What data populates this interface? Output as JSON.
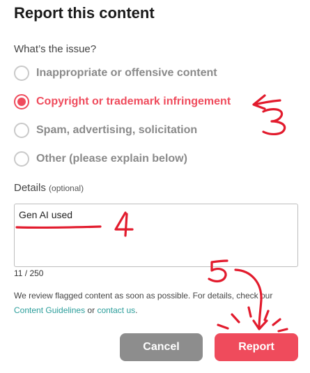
{
  "dialog": {
    "title": "Report this content",
    "question": "What’s the issue?",
    "options": [
      {
        "label": "Inappropriate or offensive content",
        "selected": false
      },
      {
        "label": "Copyright or trademark infringement",
        "selected": true
      },
      {
        "label": "Spam, advertising, solicitation",
        "selected": false
      },
      {
        "label": "Other (please explain below)",
        "selected": false
      }
    ],
    "details_label": "Details",
    "details_optional": "(optional)",
    "details_value": "Gen AI used",
    "counter": "11 / 250",
    "notice_text": "We review flagged content as soon as possible. For details, check our",
    "guidelines_link": "Content Guidelines",
    "notice_or": "or",
    "contact_link": "contact us",
    "notice_end": ".",
    "cancel_label": "Cancel",
    "report_label": "Report"
  },
  "annotations": {
    "label_3": "3",
    "label_4": "4",
    "label_5": "5"
  },
  "colors": {
    "accent": "#ef4b5c",
    "muted": "#8a8a8a",
    "link": "#2a9d9a",
    "cancel_bg": "#8d8d8d",
    "annotation": "#e21b2d"
  }
}
